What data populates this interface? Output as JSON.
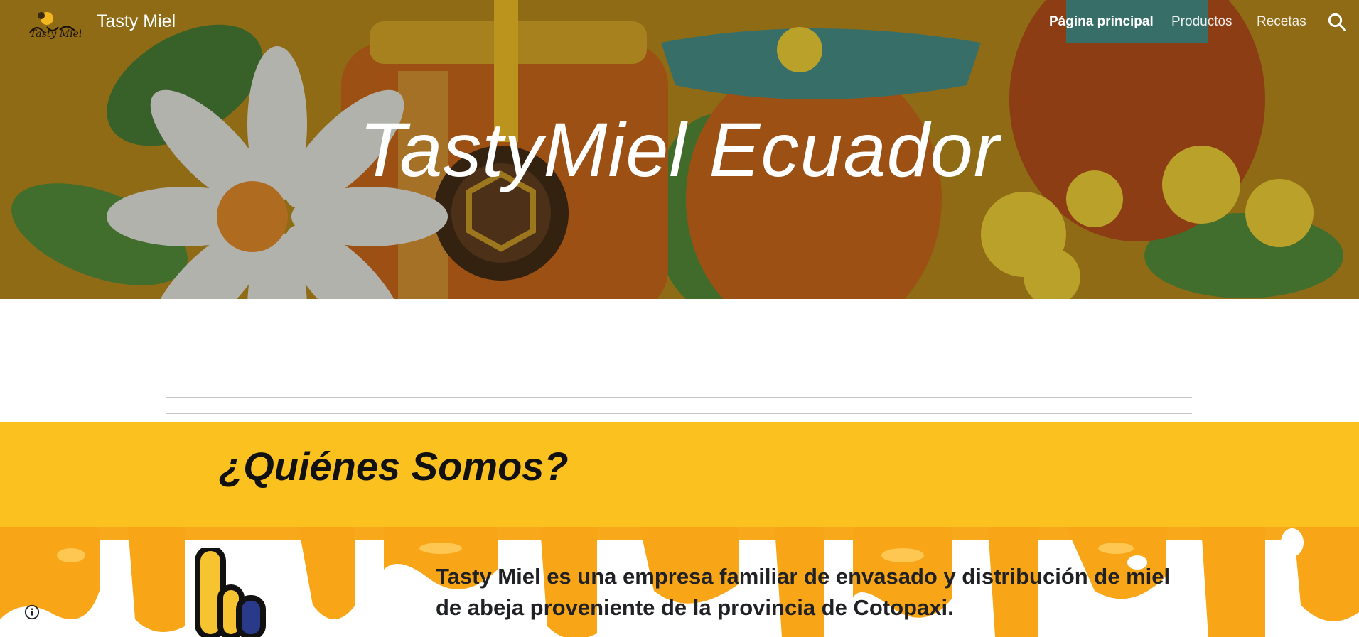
{
  "header": {
    "site_title": "Tasty Miel",
    "logo_text": "Tasty Miel",
    "nav": [
      {
        "label": "Página principal",
        "active": true
      },
      {
        "label": "Productos",
        "active": false
      },
      {
        "label": "Recetas",
        "active": false
      }
    ],
    "search_icon": "search-icon"
  },
  "hero": {
    "title": "TastyMiel Ecuador"
  },
  "about": {
    "heading": "¿Quiénes Somos?",
    "intro": "Tasty Miel es una empresa familiar de envasado y distribución de miel de abeja proveniente de la provincia de Cotopaxi."
  },
  "footer": {
    "info_icon": "info-icon"
  },
  "colors": {
    "band_yellow": "#fbc11f",
    "honey_orange": "#f7a81b",
    "hero_tint": "#8a6a1d"
  }
}
